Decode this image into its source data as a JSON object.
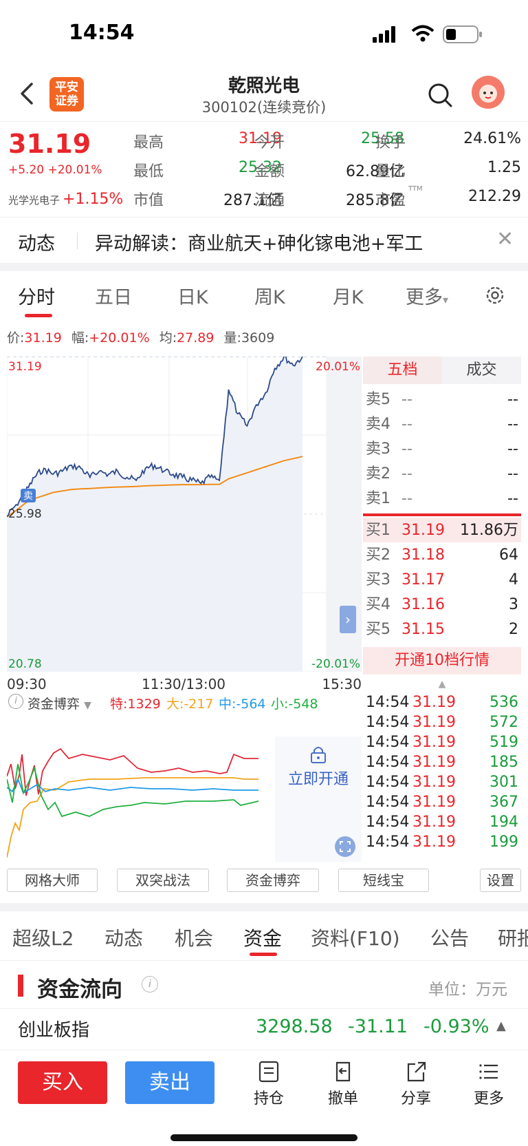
{
  "status_bar": {
    "time": "14:54"
  },
  "header": {
    "title": "乾照光电",
    "subtitle": "300102(连续竞价)",
    "logo_text_1": "平安",
    "logo_text_2": "证券"
  },
  "quote": {
    "price": "31.19",
    "change": "+5.20 +20.01%",
    "sector_name": "光学光电子",
    "sector_change": "+1.15%",
    "cells": [
      {
        "label": "最高",
        "value": "31.19",
        "color": "#e8262c"
      },
      {
        "label": "今开",
        "value": "25.58",
        "color": "#1a9b3c"
      },
      {
        "label": "换手",
        "value": "24.61%",
        "color": "#222222"
      },
      {
        "label": "最低",
        "value": "25.32",
        "color": "#1a9b3c"
      },
      {
        "label": "金额",
        "value": "62.89亿",
        "color": "#222222"
      },
      {
        "label": "量比",
        "value": "1.25",
        "color": "#222222"
      },
      {
        "label": "市值",
        "value": "287.1亿",
        "color": "#222222"
      },
      {
        "label": "流通",
        "value": "285.8亿",
        "color": "#222222"
      },
      {
        "label": "市盈",
        "value": "212.29",
        "color": "#222222"
      }
    ],
    "pe_sup": "TTM"
  },
  "news": {
    "kind": "动态",
    "text": "异动解读：商业航天+砷化镓电池+军工"
  },
  "chart_tabs": [
    "分时",
    "五日",
    "日K",
    "周K",
    "月K",
    "更多"
  ],
  "info_line": {
    "price_label": "价:",
    "price": "31.19",
    "amp_label": "幅:",
    "amp": "+20.01%",
    "avg_label": "均:",
    "avg": "27.89",
    "vol_label": "量:",
    "vol": "3609"
  },
  "chart_data": {
    "type": "line",
    "y_top": "31.19",
    "y_mid": "25.98",
    "y_bottom": "20.78",
    "pct_top": "20.01%",
    "pct_bottom": "-20.01%",
    "x_labels": [
      "09:30",
      "11:30/13:00",
      "15:30"
    ],
    "ylim": [
      20.78,
      31.19
    ],
    "series": [
      {
        "values": [
          25.9,
          26.3,
          26.7,
          27.2,
          27.5,
          27.3,
          27.4,
          27.6,
          27.5,
          27.2,
          27.4,
          27.3,
          27.4,
          27.2,
          27.1,
          27.5,
          27.6,
          27.4,
          27.3,
          27.2,
          27.1,
          27.0,
          27.2,
          27.1,
          30.1,
          29.3,
          28.9,
          29.6,
          30.0,
          30.8,
          31.19,
          30.9,
          31.19
        ]
      },
      {
        "values": [
          25.9,
          26.1,
          26.35,
          26.5,
          26.6,
          26.7,
          26.75,
          26.8,
          26.82,
          26.83,
          26.85,
          26.87,
          26.88,
          26.89,
          26.9,
          26.92,
          26.93,
          26.94,
          26.95,
          26.96,
          26.96,
          26.96,
          26.97,
          26.97,
          27.15,
          27.25,
          27.35,
          27.45,
          27.55,
          27.65,
          27.75,
          27.82,
          27.89
        ]
      }
    ]
  },
  "sell_marker": "卖",
  "orderbook": {
    "tabs": [
      "五档",
      "成交"
    ],
    "asks": [
      {
        "label": "卖5",
        "price": "--",
        "vol": "--"
      },
      {
        "label": "卖4",
        "price": "--",
        "vol": "--"
      },
      {
        "label": "卖3",
        "price": "--",
        "vol": "--"
      },
      {
        "label": "卖2",
        "price": "--",
        "vol": "--"
      },
      {
        "label": "卖1",
        "price": "--",
        "vol": "--"
      }
    ],
    "bids": [
      {
        "label": "买1",
        "price": "31.19",
        "vol": "11.86万"
      },
      {
        "label": "买2",
        "price": "31.18",
        "vol": "64"
      },
      {
        "label": "买3",
        "price": "31.17",
        "vol": "4"
      },
      {
        "label": "买4",
        "price": "31.16",
        "vol": "3"
      },
      {
        "label": "买5",
        "price": "31.15",
        "vol": "2"
      }
    ],
    "open10": "开通10档行情",
    "ticks": [
      {
        "time": "14:54",
        "price": "31.19",
        "vol": "536"
      },
      {
        "time": "14:54",
        "price": "31.19",
        "vol": "572"
      },
      {
        "time": "14:54",
        "price": "31.19",
        "vol": "519"
      },
      {
        "time": "14:54",
        "price": "31.19",
        "vol": "185"
      },
      {
        "time": "14:54",
        "price": "31.19",
        "vol": "301"
      },
      {
        "time": "14:54",
        "price": "31.19",
        "vol": "367"
      },
      {
        "time": "14:54",
        "price": "31.19",
        "vol": "194"
      },
      {
        "time": "14:54",
        "price": "31.19",
        "vol": "199"
      }
    ]
  },
  "fund": {
    "name": "资金博弈",
    "te": "特:1329",
    "da": "大:-217",
    "zhong": "中:-564",
    "xiao": "小:-548",
    "unlock": "立即开通",
    "colors": {
      "te": "#e8262c",
      "da": "#f2a41a",
      "zhong": "#1e9be8",
      "xiao": "#20b040"
    }
  },
  "tools": [
    "网格大师",
    "双突战法",
    "资金博弈",
    "短线宝",
    "设置"
  ],
  "bottom_tabs": [
    "超级L2",
    "动态",
    "机会",
    "资金",
    "资料(F10)",
    "公告",
    "研报"
  ],
  "fund_flow": {
    "title": "资金流向",
    "unit": "单位：万元"
  },
  "index": {
    "name": "创业板指",
    "value": "3298.58",
    "change": "-31.11",
    "pct": "-0.93%"
  },
  "actions": {
    "buy": "买入",
    "sell": "卖出",
    "items": [
      "持仓",
      "撤单",
      "分享",
      "更多"
    ]
  }
}
